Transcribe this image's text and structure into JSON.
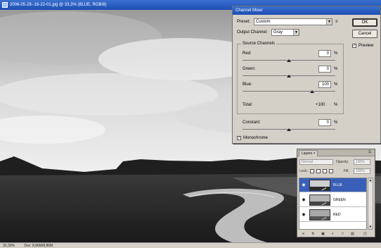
{
  "document": {
    "title": "2006-05-28--16-22-01.jpg @ 33,3% (BLUE, RGB/8)"
  },
  "status_bar": {
    "zoom": "33,33%",
    "doc_size": "Doc: 8,86M/8,86M"
  },
  "channel_mixer": {
    "title": "Channel Mixer",
    "preset_label": "Preset:",
    "preset_value": "Custom",
    "output_channel_label": "Output Channel:",
    "output_channel_value": "Gray",
    "source_channels_label": "Source Channels",
    "red_label": "Red:",
    "red_value": "0",
    "green_label": "Green:",
    "green_value": "0",
    "blue_label": "Blue:",
    "blue_value": "100",
    "percent_sign": "%",
    "total_label": "Total:",
    "total_value": "+100",
    "constant_label": "Constant:",
    "constant_value": "0",
    "monochrome_label": "Monochrome",
    "monochrome_checked": true,
    "ok_label": "OK",
    "cancel_label": "Cancel",
    "preview_label": "Preview",
    "preview_checked": true,
    "slider_levels": {
      "red": 0,
      "green": 0,
      "blue": 100,
      "constant": 0
    }
  },
  "layers_panel": {
    "tab_label": "Layers ×",
    "blend_mode": "Normal",
    "opacity_label": "Opacity:",
    "opacity_value": "100%",
    "lock_label": "Lock:",
    "fill_label": "Fill:",
    "fill_value": "100%",
    "layers": [
      {
        "name": "BLUE",
        "active": true
      },
      {
        "name": "GREEN",
        "active": false
      },
      {
        "name": "RED",
        "active": false
      }
    ],
    "bottom_icons": [
      "link-icon",
      "fx-icon",
      "mask-icon",
      "adjustment-icon",
      "folder-icon",
      "new-layer-icon",
      "trash-icon"
    ]
  },
  "colors": {
    "titlebar": "#1d4fb3",
    "active_layer": "#3a5fb8",
    "dialog_bg": "#d4d0c8"
  }
}
